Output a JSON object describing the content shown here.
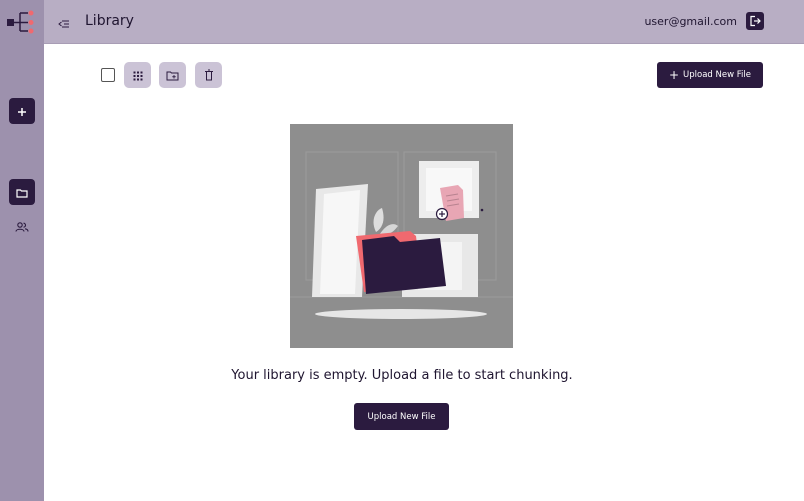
{
  "header": {
    "title": "Library",
    "user_email": "user@gmail.com",
    "menu_icon": "collapse-menu-icon",
    "logout_icon": "logout-icon"
  },
  "sidebar": {
    "logo_icon": "tree-logo-icon",
    "items": [
      {
        "name": "add",
        "icon": "plus-icon"
      },
      {
        "name": "library",
        "icon": "folder-icon",
        "active": true
      },
      {
        "name": "users",
        "icon": "users-icon"
      }
    ]
  },
  "toolbar": {
    "select_all_icon": "checkbox",
    "grid_view_icon": "grid-icon",
    "new_folder_icon": "folder-add-icon",
    "delete_icon": "trash-icon",
    "upload_label": "Upload New File",
    "upload_icon": "plus-icon"
  },
  "main": {
    "empty_message": "Your library is empty. Upload a file to start chunking.",
    "upload_label": "Upload New File",
    "illustration_icon": "empty-library-illustration"
  },
  "colors": {
    "primary": "#2b1b3f",
    "sidebar": "#9d91ad",
    "header": "#b8aec4",
    "tool_button": "#cbc3d6",
    "accent": "#f0696f"
  }
}
